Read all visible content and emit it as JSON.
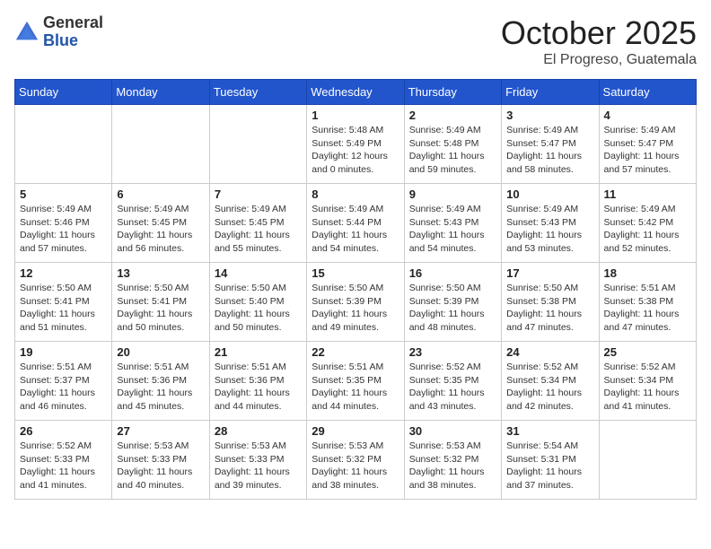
{
  "logo": {
    "general": "General",
    "blue": "Blue"
  },
  "title": "October 2025",
  "subtitle": "El Progreso, Guatemala",
  "weekdays": [
    "Sunday",
    "Monday",
    "Tuesday",
    "Wednesday",
    "Thursday",
    "Friday",
    "Saturday"
  ],
  "weeks": [
    [
      {
        "day": "",
        "info": ""
      },
      {
        "day": "",
        "info": ""
      },
      {
        "day": "",
        "info": ""
      },
      {
        "day": "1",
        "info": "Sunrise: 5:48 AM\nSunset: 5:49 PM\nDaylight: 12 hours\nand 0 minutes."
      },
      {
        "day": "2",
        "info": "Sunrise: 5:49 AM\nSunset: 5:48 PM\nDaylight: 11 hours\nand 59 minutes."
      },
      {
        "day": "3",
        "info": "Sunrise: 5:49 AM\nSunset: 5:47 PM\nDaylight: 11 hours\nand 58 minutes."
      },
      {
        "day": "4",
        "info": "Sunrise: 5:49 AM\nSunset: 5:47 PM\nDaylight: 11 hours\nand 57 minutes."
      }
    ],
    [
      {
        "day": "5",
        "info": "Sunrise: 5:49 AM\nSunset: 5:46 PM\nDaylight: 11 hours\nand 57 minutes."
      },
      {
        "day": "6",
        "info": "Sunrise: 5:49 AM\nSunset: 5:45 PM\nDaylight: 11 hours\nand 56 minutes."
      },
      {
        "day": "7",
        "info": "Sunrise: 5:49 AM\nSunset: 5:45 PM\nDaylight: 11 hours\nand 55 minutes."
      },
      {
        "day": "8",
        "info": "Sunrise: 5:49 AM\nSunset: 5:44 PM\nDaylight: 11 hours\nand 54 minutes."
      },
      {
        "day": "9",
        "info": "Sunrise: 5:49 AM\nSunset: 5:43 PM\nDaylight: 11 hours\nand 54 minutes."
      },
      {
        "day": "10",
        "info": "Sunrise: 5:49 AM\nSunset: 5:43 PM\nDaylight: 11 hours\nand 53 minutes."
      },
      {
        "day": "11",
        "info": "Sunrise: 5:49 AM\nSunset: 5:42 PM\nDaylight: 11 hours\nand 52 minutes."
      }
    ],
    [
      {
        "day": "12",
        "info": "Sunrise: 5:50 AM\nSunset: 5:41 PM\nDaylight: 11 hours\nand 51 minutes."
      },
      {
        "day": "13",
        "info": "Sunrise: 5:50 AM\nSunset: 5:41 PM\nDaylight: 11 hours\nand 50 minutes."
      },
      {
        "day": "14",
        "info": "Sunrise: 5:50 AM\nSunset: 5:40 PM\nDaylight: 11 hours\nand 50 minutes."
      },
      {
        "day": "15",
        "info": "Sunrise: 5:50 AM\nSunset: 5:39 PM\nDaylight: 11 hours\nand 49 minutes."
      },
      {
        "day": "16",
        "info": "Sunrise: 5:50 AM\nSunset: 5:39 PM\nDaylight: 11 hours\nand 48 minutes."
      },
      {
        "day": "17",
        "info": "Sunrise: 5:50 AM\nSunset: 5:38 PM\nDaylight: 11 hours\nand 47 minutes."
      },
      {
        "day": "18",
        "info": "Sunrise: 5:51 AM\nSunset: 5:38 PM\nDaylight: 11 hours\nand 47 minutes."
      }
    ],
    [
      {
        "day": "19",
        "info": "Sunrise: 5:51 AM\nSunset: 5:37 PM\nDaylight: 11 hours\nand 46 minutes."
      },
      {
        "day": "20",
        "info": "Sunrise: 5:51 AM\nSunset: 5:36 PM\nDaylight: 11 hours\nand 45 minutes."
      },
      {
        "day": "21",
        "info": "Sunrise: 5:51 AM\nSunset: 5:36 PM\nDaylight: 11 hours\nand 44 minutes."
      },
      {
        "day": "22",
        "info": "Sunrise: 5:51 AM\nSunset: 5:35 PM\nDaylight: 11 hours\nand 44 minutes."
      },
      {
        "day": "23",
        "info": "Sunrise: 5:52 AM\nSunset: 5:35 PM\nDaylight: 11 hours\nand 43 minutes."
      },
      {
        "day": "24",
        "info": "Sunrise: 5:52 AM\nSunset: 5:34 PM\nDaylight: 11 hours\nand 42 minutes."
      },
      {
        "day": "25",
        "info": "Sunrise: 5:52 AM\nSunset: 5:34 PM\nDaylight: 11 hours\nand 41 minutes."
      }
    ],
    [
      {
        "day": "26",
        "info": "Sunrise: 5:52 AM\nSunset: 5:33 PM\nDaylight: 11 hours\nand 41 minutes."
      },
      {
        "day": "27",
        "info": "Sunrise: 5:53 AM\nSunset: 5:33 PM\nDaylight: 11 hours\nand 40 minutes."
      },
      {
        "day": "28",
        "info": "Sunrise: 5:53 AM\nSunset: 5:33 PM\nDaylight: 11 hours\nand 39 minutes."
      },
      {
        "day": "29",
        "info": "Sunrise: 5:53 AM\nSunset: 5:32 PM\nDaylight: 11 hours\nand 38 minutes."
      },
      {
        "day": "30",
        "info": "Sunrise: 5:53 AM\nSunset: 5:32 PM\nDaylight: 11 hours\nand 38 minutes."
      },
      {
        "day": "31",
        "info": "Sunrise: 5:54 AM\nSunset: 5:31 PM\nDaylight: 11 hours\nand 37 minutes."
      },
      {
        "day": "",
        "info": ""
      }
    ]
  ]
}
